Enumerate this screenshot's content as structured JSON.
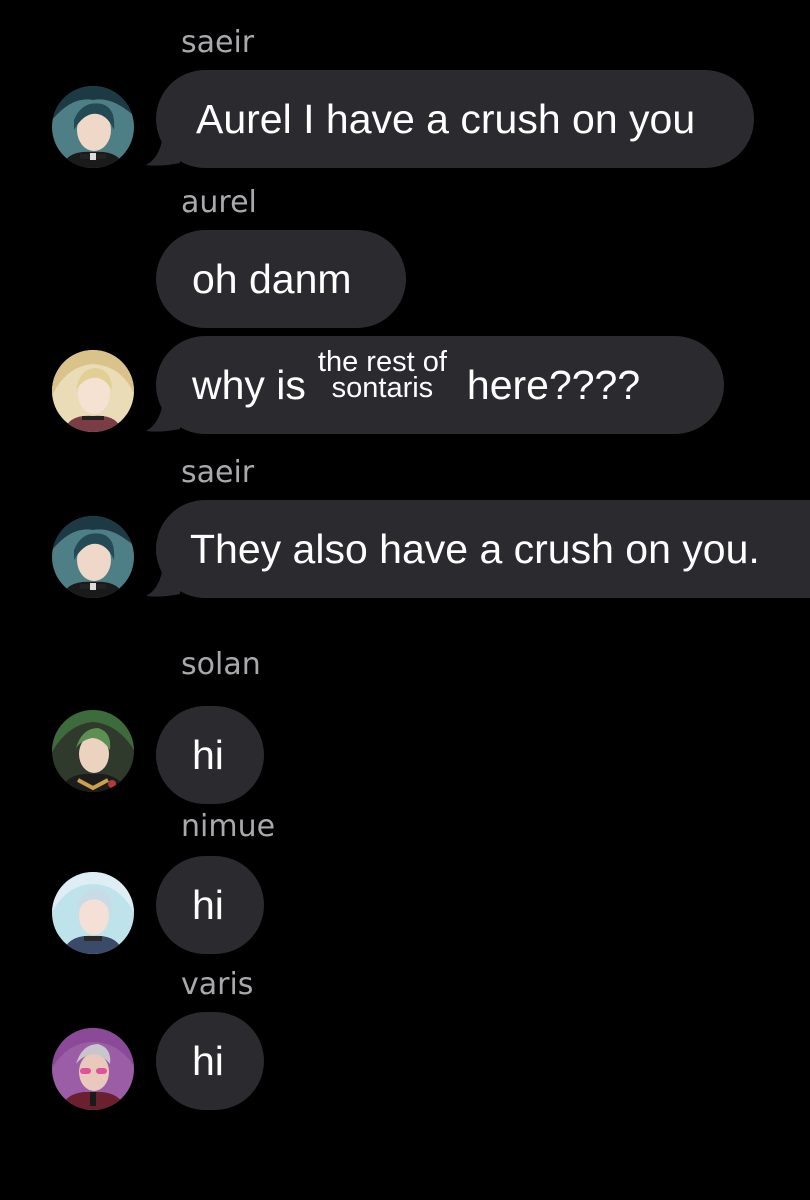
{
  "messages": [
    {
      "sender": "saeir",
      "text": "Aurel I have a crush on you",
      "avatar": "saeir-avatar"
    },
    {
      "sender": "aurel",
      "text": "oh danm"
    },
    {
      "text_before": "why is",
      "overlay_line1": "the rest of",
      "overlay_line2": "sontaris",
      "text_after": "here????",
      "avatar": "aurel-avatar"
    },
    {
      "sender": "saeir",
      "text": "They also have a crush on you.",
      "avatar": "saeir-avatar"
    },
    {
      "sender": "solan",
      "text": "hi",
      "avatar": "solan-avatar"
    },
    {
      "sender": "nimue",
      "text": "hi",
      "avatar": "nimue-avatar"
    },
    {
      "sender": "varis",
      "text": "hi",
      "avatar": "varis-avatar"
    }
  ],
  "colors": {
    "background": "#000000",
    "bubble": "#2b2a2e",
    "sender_name": "#a9a9ad",
    "message_text": "#ffffff"
  }
}
